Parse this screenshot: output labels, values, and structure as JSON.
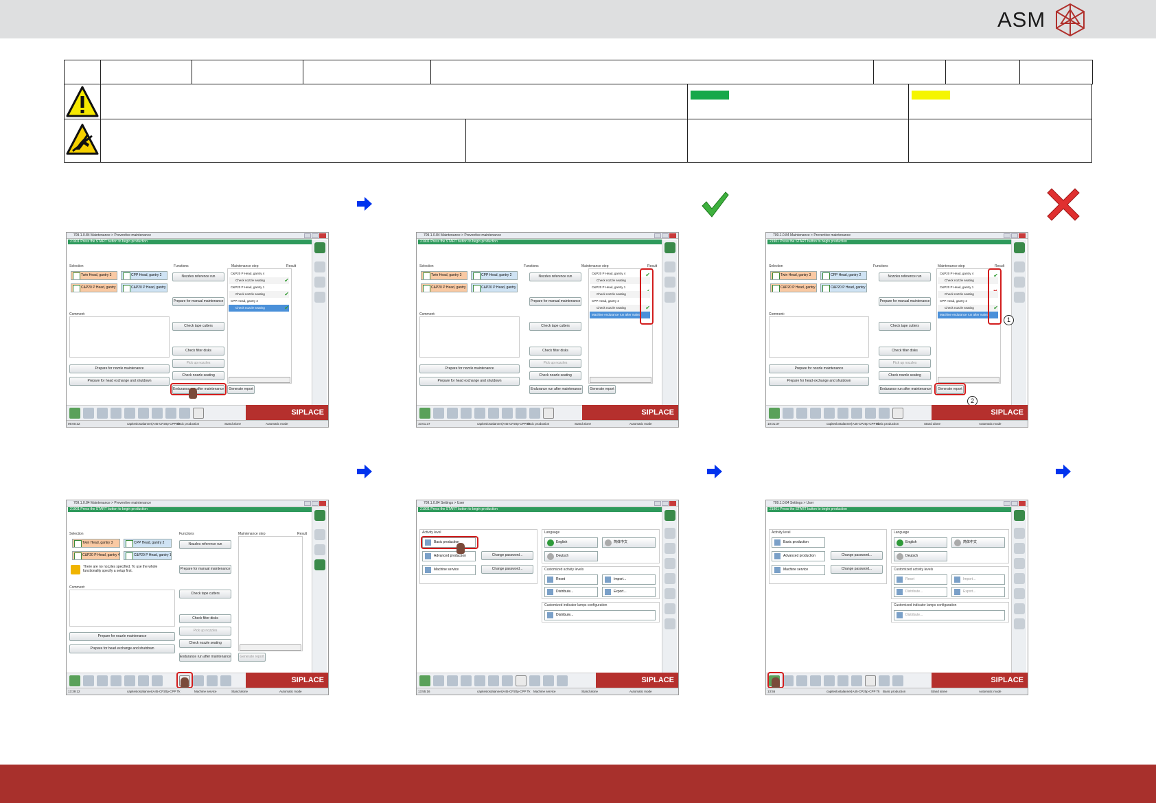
{
  "header": {
    "brand": "ASM",
    "logo_icon": "asm-crystal-logo-icon",
    "accent_color": "#a8302c",
    "band_color": "#dedfe0"
  },
  "symbols": {
    "warning_icon": "general-warning-triangle-icon",
    "esd_icon": "esd-warning-icon",
    "green_swatch": "#16a84a",
    "yellow_swatch": "#f5f500",
    "arrow_icon": "blue-right-arrow-icon",
    "check_icon": "green-check-icon",
    "cross_icon": "red-cross-icon"
  },
  "maintenance": {
    "title": "709.1.0.84 Maintenance > Preventive maintenance",
    "message": "21901 Press the START button to begin production",
    "selection_label": "Selection",
    "functions_label": "Functions",
    "step_label": "Maintenance step",
    "result_label": "Result",
    "comment_label": "Comment:",
    "gantry": [
      "Twin Head, gantry 3",
      "CPP Head, gantry 2",
      "C&P20 P Head, gantry 4",
      "C&P20 P Head, gantry 1"
    ],
    "functions": [
      "Nozzles reference run",
      "Prepare for manual maintenance",
      "Check tape cutters",
      "Check filter disks",
      "Pick up nozzles",
      "Check nozzle seating",
      "Endurance run after maintenance"
    ],
    "prep_nozzle": "Prepare for nozzle maintenance",
    "prep_head": "Prepare for head exchange and shutdown",
    "generate": "Generate report",
    "steps": [
      "C&P20 P Head, gantry 4",
      "Check nozzle seating",
      "C&P20 P Head, gantry 1",
      "Check nozzle seating",
      "CPP Head, gantry 2",
      "Check nozzle seating",
      "Machine endurance run after mainte"
    ],
    "no_nozzles": "There are no nozzles specified. To use the whole functionality specify a setup first.",
    "brand": "SIPLACE",
    "status_path": "capiteslostalanner|A45-CP20p-CPP Tk",
    "status_level": "Basic production",
    "status_level_service": "Machine service",
    "status_mode": "Stand alone",
    "status_auto": "Automatic mode",
    "times": [
      "09:00:32",
      "10:01:37",
      "10:01:37",
      "13:39:12"
    ]
  },
  "user_settings": {
    "title": "709.1.0.84 Settings > User",
    "message": "21901 Press the START button to begin production",
    "activity_level": "Activity level",
    "levels": [
      "Basic production",
      "Advanced production",
      "Machine service"
    ],
    "change_password": "Change password...",
    "language": "Language",
    "english": "English",
    "chinese": "简体中文",
    "deutsch": "Deutsch",
    "custom_levels": "Customized activity levels",
    "reset": "Reset",
    "import": "Import...",
    "distribute": "Distribute...",
    "export": "Export...",
    "custom_lamps": "Customized indicator lamps configuration",
    "time": "13:55:16",
    "time2": "13:55"
  },
  "callouts": [
    "1",
    "2"
  ]
}
